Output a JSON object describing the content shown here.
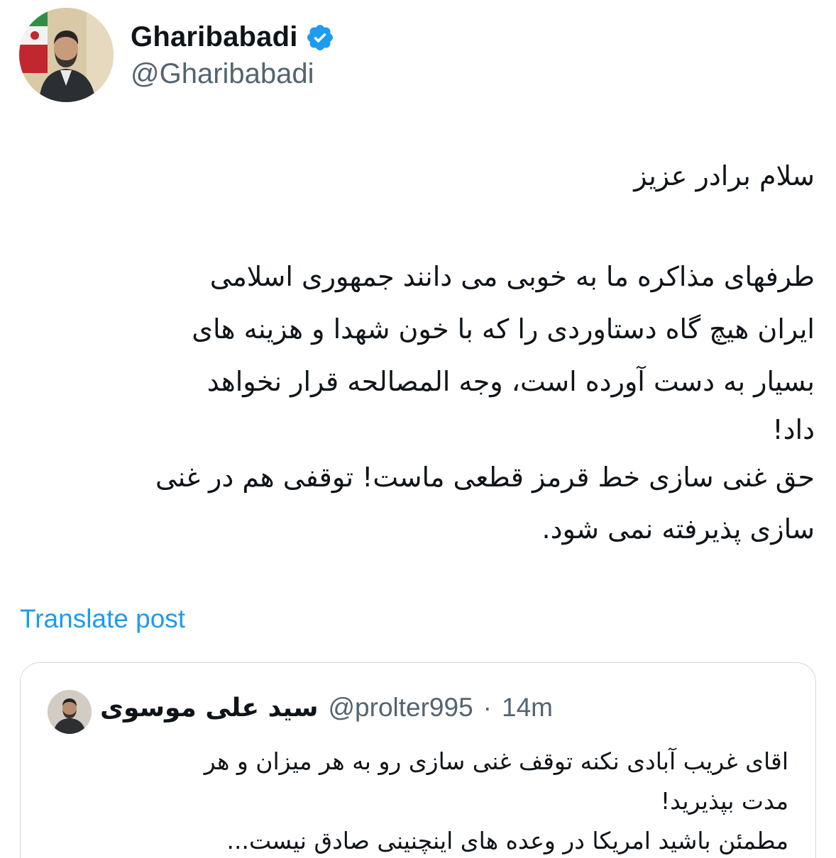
{
  "author": {
    "display_name": "Gharibabadi",
    "handle": "@Gharibabadi",
    "verified": true,
    "verified_color": "#1d9bf0"
  },
  "post": {
    "greeting": "سلام برادر عزیز",
    "lines": [
      "طرفهای مذاکره ما به خوبی می دانند جمهوری اسلامی",
      "ایران هیچ گاه دستاوردی را که با خون شهدا و هزینه های",
      "بسیار به دست آورده است، وجه المصالحه قرار نخواهد",
      "داد!",
      "حق غنی سازی خط قرمز قطعی ماست! توقفی هم در غنی",
      "سازی پذیرفته نمی شود."
    ]
  },
  "translate_label": "Translate post",
  "quoted_post": {
    "name": "سید علی موسوی",
    "handle": "@prolter995",
    "separator": "·",
    "time": "14m",
    "lines": [
      "اقای غریب آبادی نکنه توقف غنی سازی رو به هر میزان و هر",
      "مدت بپذیرید!",
      "مطمئن باشید امریکا در وعده های اینچنینی صادق نیست..."
    ]
  },
  "colors": {
    "link": "#1d9bf0",
    "secondary_text": "#536471",
    "border": "#cfd9de"
  }
}
